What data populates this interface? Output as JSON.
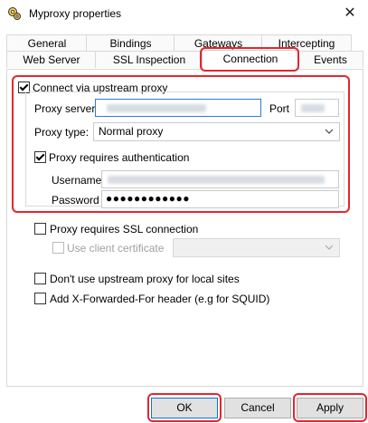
{
  "window": {
    "title": "Myproxy properties",
    "close_glyph": "✕"
  },
  "tabs": {
    "row1": [
      "General",
      "Bindings",
      "Gateways",
      "Intercepting"
    ],
    "row2": [
      "Web Server",
      "SSL Inspection",
      "Connection",
      "Events"
    ],
    "active": "Connection"
  },
  "connection": {
    "upstream_proxy": {
      "label": "Connect via upstream proxy",
      "checked": true
    },
    "proxy_server": {
      "label": "Proxy server",
      "value_obscured": true
    },
    "port": {
      "label": "Port",
      "value_obscured": true
    },
    "proxy_type": {
      "label": "Proxy type:",
      "value": "Normal proxy"
    },
    "auth": {
      "label": "Proxy requires authentication",
      "checked": true
    },
    "username": {
      "label": "Username",
      "value_obscured": true
    },
    "password": {
      "label": "Password",
      "value": "●●●●●●●●●●●●"
    },
    "ssl_connection": {
      "label": "Proxy requires SSL connection",
      "checked": false
    },
    "client_cert": {
      "label": "Use client certificate",
      "checked": false,
      "disabled": true
    },
    "no_local": {
      "label": "Don't use upstream proxy for local sites",
      "checked": false
    },
    "xff": {
      "label": "Add X-Forwarded-For header (e.g for SQUID)",
      "checked": false
    }
  },
  "buttons": {
    "ok": "OK",
    "cancel": "Cancel",
    "apply": "Apply"
  },
  "colors": {
    "highlight": "#e3262d",
    "focus_border": "#2d7dd2"
  }
}
